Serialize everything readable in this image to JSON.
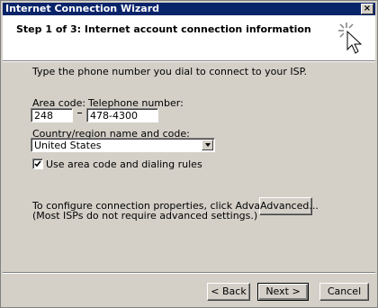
{
  "window": {
    "title": "Internet Connection Wizard",
    "close_glyph": "×"
  },
  "header": {
    "step_title": "Step 1 of 3: Internet account connection information",
    "icon": "wizard-sparkle-cursor-icon"
  },
  "form": {
    "instruction": "Type the phone number you dial to connect to your ISP.",
    "area_code_label": "Area code:",
    "area_code_value": "248",
    "phone_label": "Telephone number:",
    "phone_value": "478-4300",
    "country_label": "Country/region name and code:",
    "country_value": "United States",
    "dialing_rules_label": "Use area code and dialing rules",
    "dialing_rules_checked": true
  },
  "advanced": {
    "line1": "To configure connection properties, click Advanced.",
    "line2": "(Most ISPs do not require advanced settings.)",
    "button_label": "Advanced..."
  },
  "footer": {
    "back_label": "< Back",
    "next_label": "Next >",
    "cancel_label": "Cancel"
  },
  "colors": {
    "titlebar": "#0a246a",
    "face": "#d4d0c8",
    "header_bg": "#ffffff"
  }
}
